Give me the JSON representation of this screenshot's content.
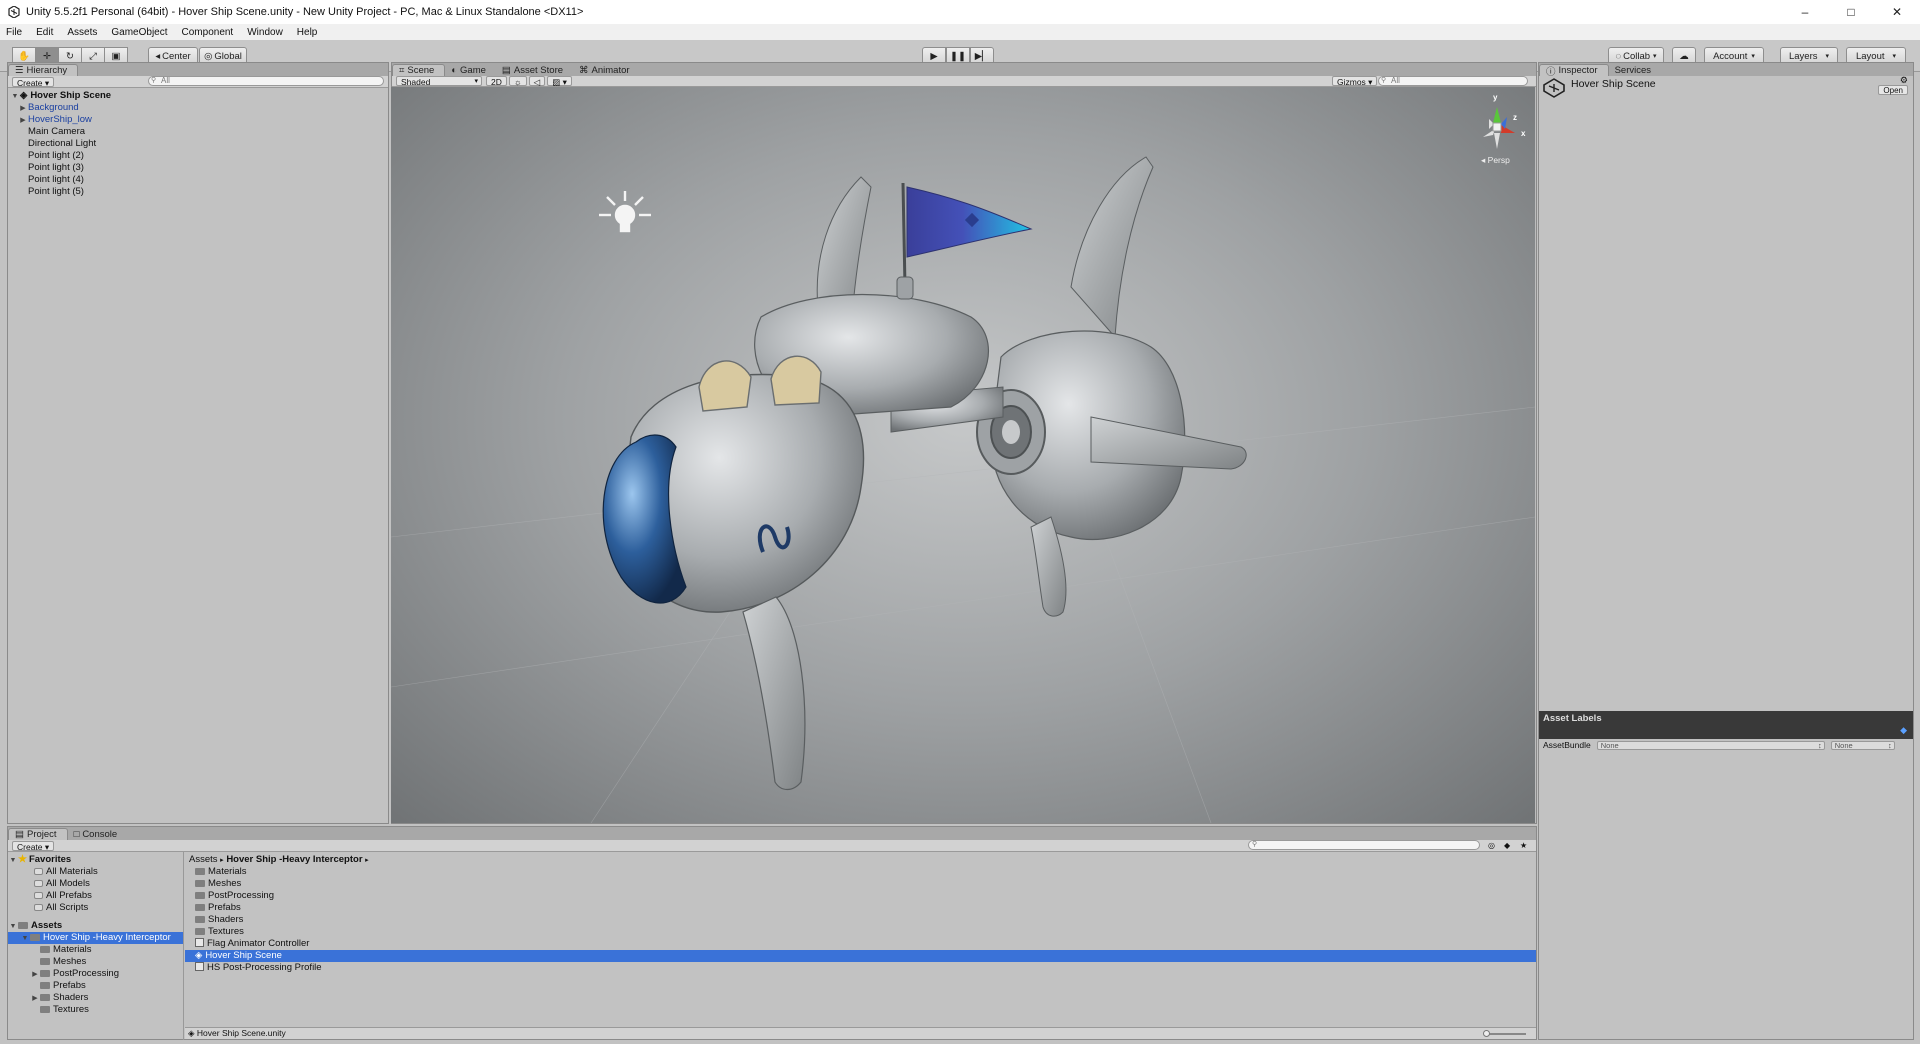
{
  "window": {
    "title": "Unity 5.5.2f1 Personal (64bit) - Hover Ship Scene.unity - New Unity Project - PC, Mac & Linux Standalone <DX11>"
  },
  "menu": [
    "File",
    "Edit",
    "Assets",
    "GameObject",
    "Component",
    "Window",
    "Help"
  ],
  "toolbar": {
    "center_label": "Center",
    "global_label": "Global",
    "collab_label": "Collab",
    "account_label": "Account",
    "layers_label": "Layers",
    "layout_label": "Layout"
  },
  "hierarchy": {
    "tab": "Hierarchy",
    "create": "Create",
    "search_placeholder": "All",
    "scene_name": "Hover Ship Scene",
    "items": [
      {
        "label": "Background",
        "expandable": true,
        "prefab": true
      },
      {
        "label": "HoverShip_low",
        "expandable": true,
        "prefab": true
      },
      {
        "label": "Main Camera",
        "expandable": false,
        "prefab": false
      },
      {
        "label": "Directional Light",
        "expandable": false,
        "prefab": false
      },
      {
        "label": "Point light (2)",
        "expandable": false,
        "prefab": false
      },
      {
        "label": "Point light (3)",
        "expandable": false,
        "prefab": false
      },
      {
        "label": "Point light (4)",
        "expandable": false,
        "prefab": false
      },
      {
        "label": "Point light (5)",
        "expandable": false,
        "prefab": false
      }
    ]
  },
  "center_tabs": [
    "Scene",
    "Game",
    "Asset Store",
    "Animator"
  ],
  "scene_toolbar": {
    "shading": "Shaded",
    "mode_2d": "2D",
    "gizmos": "Gizmos",
    "search_placeholder": "All"
  },
  "scene_gizmo": {
    "y": "y",
    "z": "z",
    "x": "x",
    "persp": "Persp"
  },
  "inspector": {
    "tabs": [
      "Inspector",
      "Services"
    ],
    "object_name": "Hover Ship Scene",
    "open_button": "Open",
    "asset_labels": "Asset Labels",
    "assetbundle_label": "AssetBundle",
    "assetbundle_value": "None",
    "assetbundle_variant": "None"
  },
  "project": {
    "tabs": [
      "Project",
      "Console"
    ],
    "create": "Create",
    "favorites_label": "Favorites",
    "favorites": [
      "All Materials",
      "All Models",
      "All Prefabs",
      "All Scripts"
    ],
    "assets_label": "Assets",
    "assets_tree": [
      {
        "label": "Hover Ship -Heavy Interceptor",
        "level": 1,
        "expandable": true,
        "selected": true
      },
      {
        "label": "Materials",
        "level": 2,
        "expandable": false
      },
      {
        "label": "Meshes",
        "level": 2,
        "expandable": false
      },
      {
        "label": "PostProcessing",
        "level": 2,
        "expandable": true
      },
      {
        "label": "Prefabs",
        "level": 2,
        "expandable": false
      },
      {
        "label": "Shaders",
        "level": 2,
        "expandable": true
      },
      {
        "label": "Textures",
        "level": 2,
        "expandable": false
      }
    ],
    "breadcrumb_root": "Assets",
    "breadcrumb_folder": "Hover Ship -Heavy Interceptor",
    "contents": [
      {
        "label": "Materials",
        "type": "folder"
      },
      {
        "label": "Meshes",
        "type": "folder"
      },
      {
        "label": "PostProcessing",
        "type": "folder"
      },
      {
        "label": "Prefabs",
        "type": "folder"
      },
      {
        "label": "Shaders",
        "type": "folder"
      },
      {
        "label": "Textures",
        "type": "folder"
      },
      {
        "label": "Flag Animator Controller",
        "type": "animator"
      },
      {
        "label": "Hover Ship Scene",
        "type": "scene",
        "selected": true
      },
      {
        "label": "HS Post-Processing Profile",
        "type": "asset"
      }
    ],
    "status_path": "Hover Ship Scene.unity"
  },
  "colors": {
    "selection": "#3a72d8",
    "prefab_text": "#1a3fa0",
    "panel": "#c2c2c2"
  }
}
